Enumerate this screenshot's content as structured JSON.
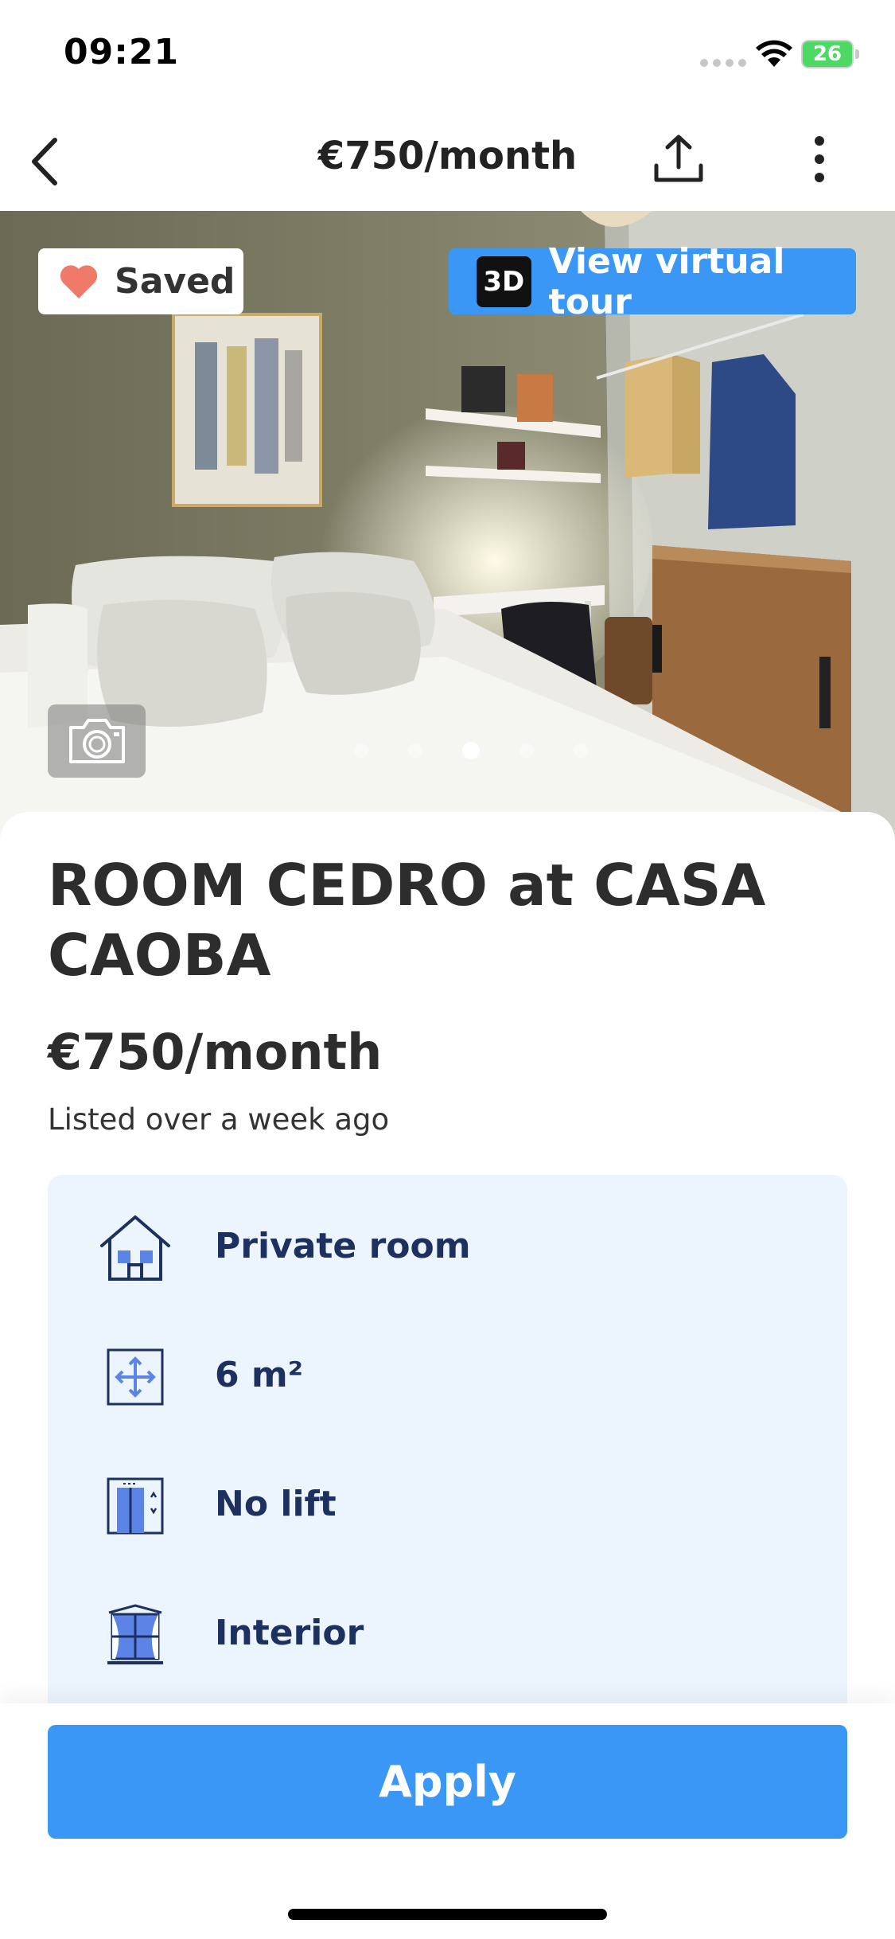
{
  "status_bar": {
    "time": "09:21",
    "battery": "26"
  },
  "nav": {
    "title": "€750/month",
    "back_icon": "chevron-left-icon",
    "share_icon": "share-icon",
    "more_icon": "more-vertical-icon"
  },
  "hero": {
    "saved_label": "Saved",
    "tour_badge": "3D",
    "tour_label": "View virtual tour",
    "photo_count": 5,
    "active_photo": 3,
    "camera_icon": "camera-icon"
  },
  "listing": {
    "title": "ROOM CEDRO at CASA CAOBA",
    "price": "€750/month",
    "listed": "Listed over a week ago"
  },
  "features": [
    {
      "icon": "house-icon",
      "label": "Private room"
    },
    {
      "icon": "area-icon",
      "label": "6 m²"
    },
    {
      "icon": "lift-icon",
      "label": "No lift"
    },
    {
      "icon": "window-icon",
      "label": "Interior"
    }
  ],
  "cta": {
    "apply_label": "Apply"
  },
  "colors": {
    "accent": "#3b97f5",
    "feature_bg": "#ecf4fd",
    "feature_text": "#1d3160",
    "heart": "#f07a6a",
    "battery": "#4cd964"
  }
}
